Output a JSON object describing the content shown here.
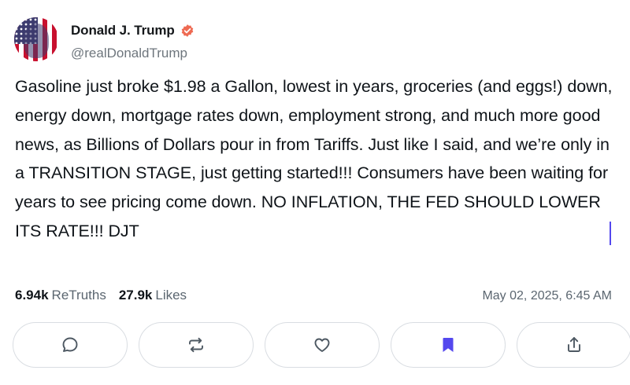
{
  "author": {
    "display_name": "Donald J. Trump",
    "handle": "@realDonaldTrump",
    "verified": true
  },
  "post": {
    "text": "Gasoline just broke $1.98 a Gallon, lowest in years, groceries (and eggs!) down, energy down, mortgage rates down, employment strong, and much more good news, as Billions of Dollars pour in from Tariffs. Just like I said, and we’re only in a TRANSITION STAGE, just getting started!!! Consumers have been waiting for years to see pricing come down. NO INFLATION, THE FED SHOULD LOWER ITS RATE!!! DJT"
  },
  "stats": {
    "retruths_count": "6.94k",
    "retruths_label": "ReTruths",
    "likes_count": "27.9k",
    "likes_label": "Likes"
  },
  "timestamp": "May 02, 2025, 6:45 AM",
  "actions": [
    {
      "name": "reply",
      "icon": "comment-icon"
    },
    {
      "name": "retruth",
      "icon": "repost-icon"
    },
    {
      "name": "like",
      "icon": "heart-icon"
    },
    {
      "name": "bookmark",
      "icon": "bookmark-icon",
      "active": true
    },
    {
      "name": "share",
      "icon": "share-icon"
    }
  ],
  "colors": {
    "accent": "#5448ee",
    "verified_badge": "#ee6a52",
    "muted_text": "#5b6670",
    "button_border": "#d9dde2"
  }
}
